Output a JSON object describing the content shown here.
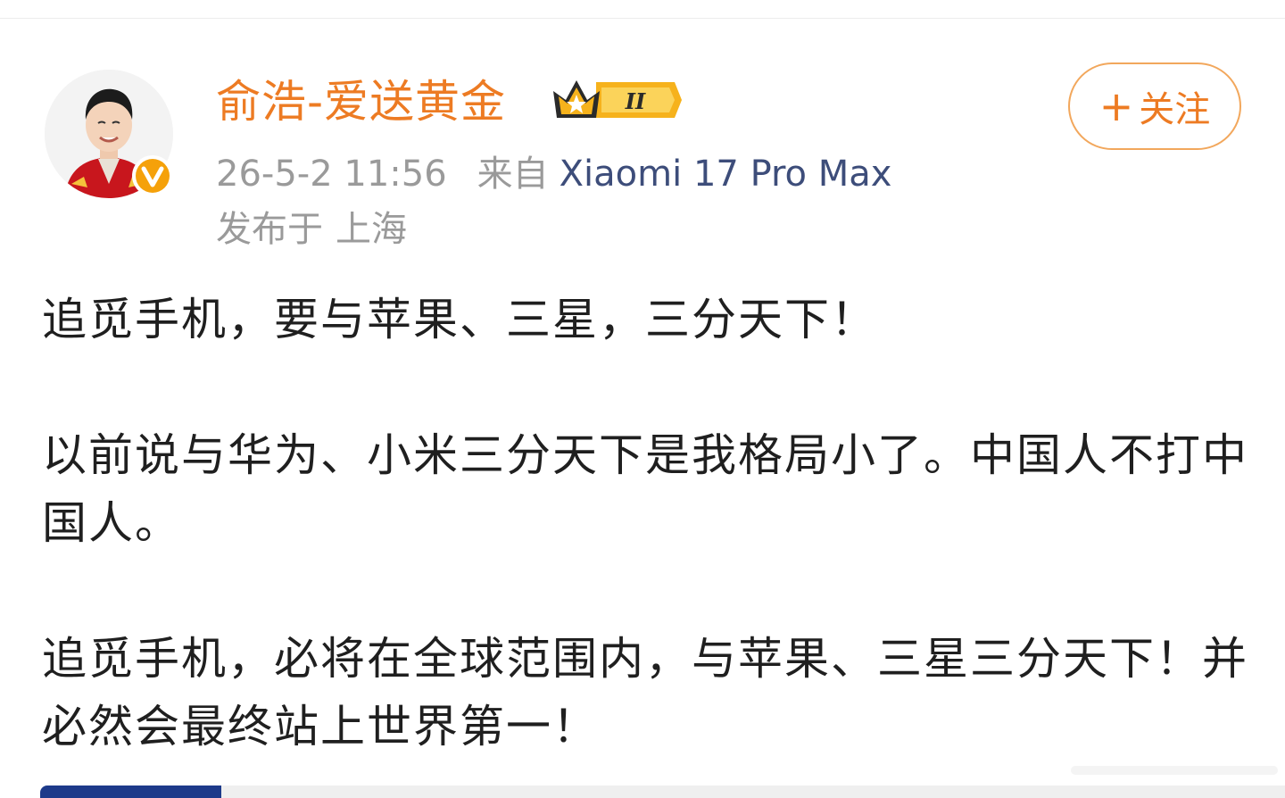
{
  "post": {
    "author": {
      "name": "俞浩-爱送黄金",
      "verified_icon": "verified-v-icon",
      "member_badge": {
        "icon": "crown-icon",
        "level_text": "II"
      }
    },
    "follow_button": {
      "icon": "plus-icon",
      "label": "关注"
    },
    "meta": {
      "timestamp": "26-5-2 11:56",
      "source_prefix": "来自",
      "device": "Xiaomi 17 Pro Max",
      "location_prefix": "发布于",
      "location": "上海"
    },
    "paragraphs": [
      "追觅手机，要与苹果、三星，三分天下！",
      "以前说与华为、小米三分天下是我格局小了。中国人不打中国人。",
      "追觅手机，必将在全球范围内，与苹果、三星三分天下！并必然会最终站上世界第一！"
    ]
  },
  "colors": {
    "accent_orange": "#ed7b23",
    "device_link_blue": "#3d4d7a",
    "meta_gray": "#9a9a9a",
    "body_text": "#1f1f1f"
  }
}
